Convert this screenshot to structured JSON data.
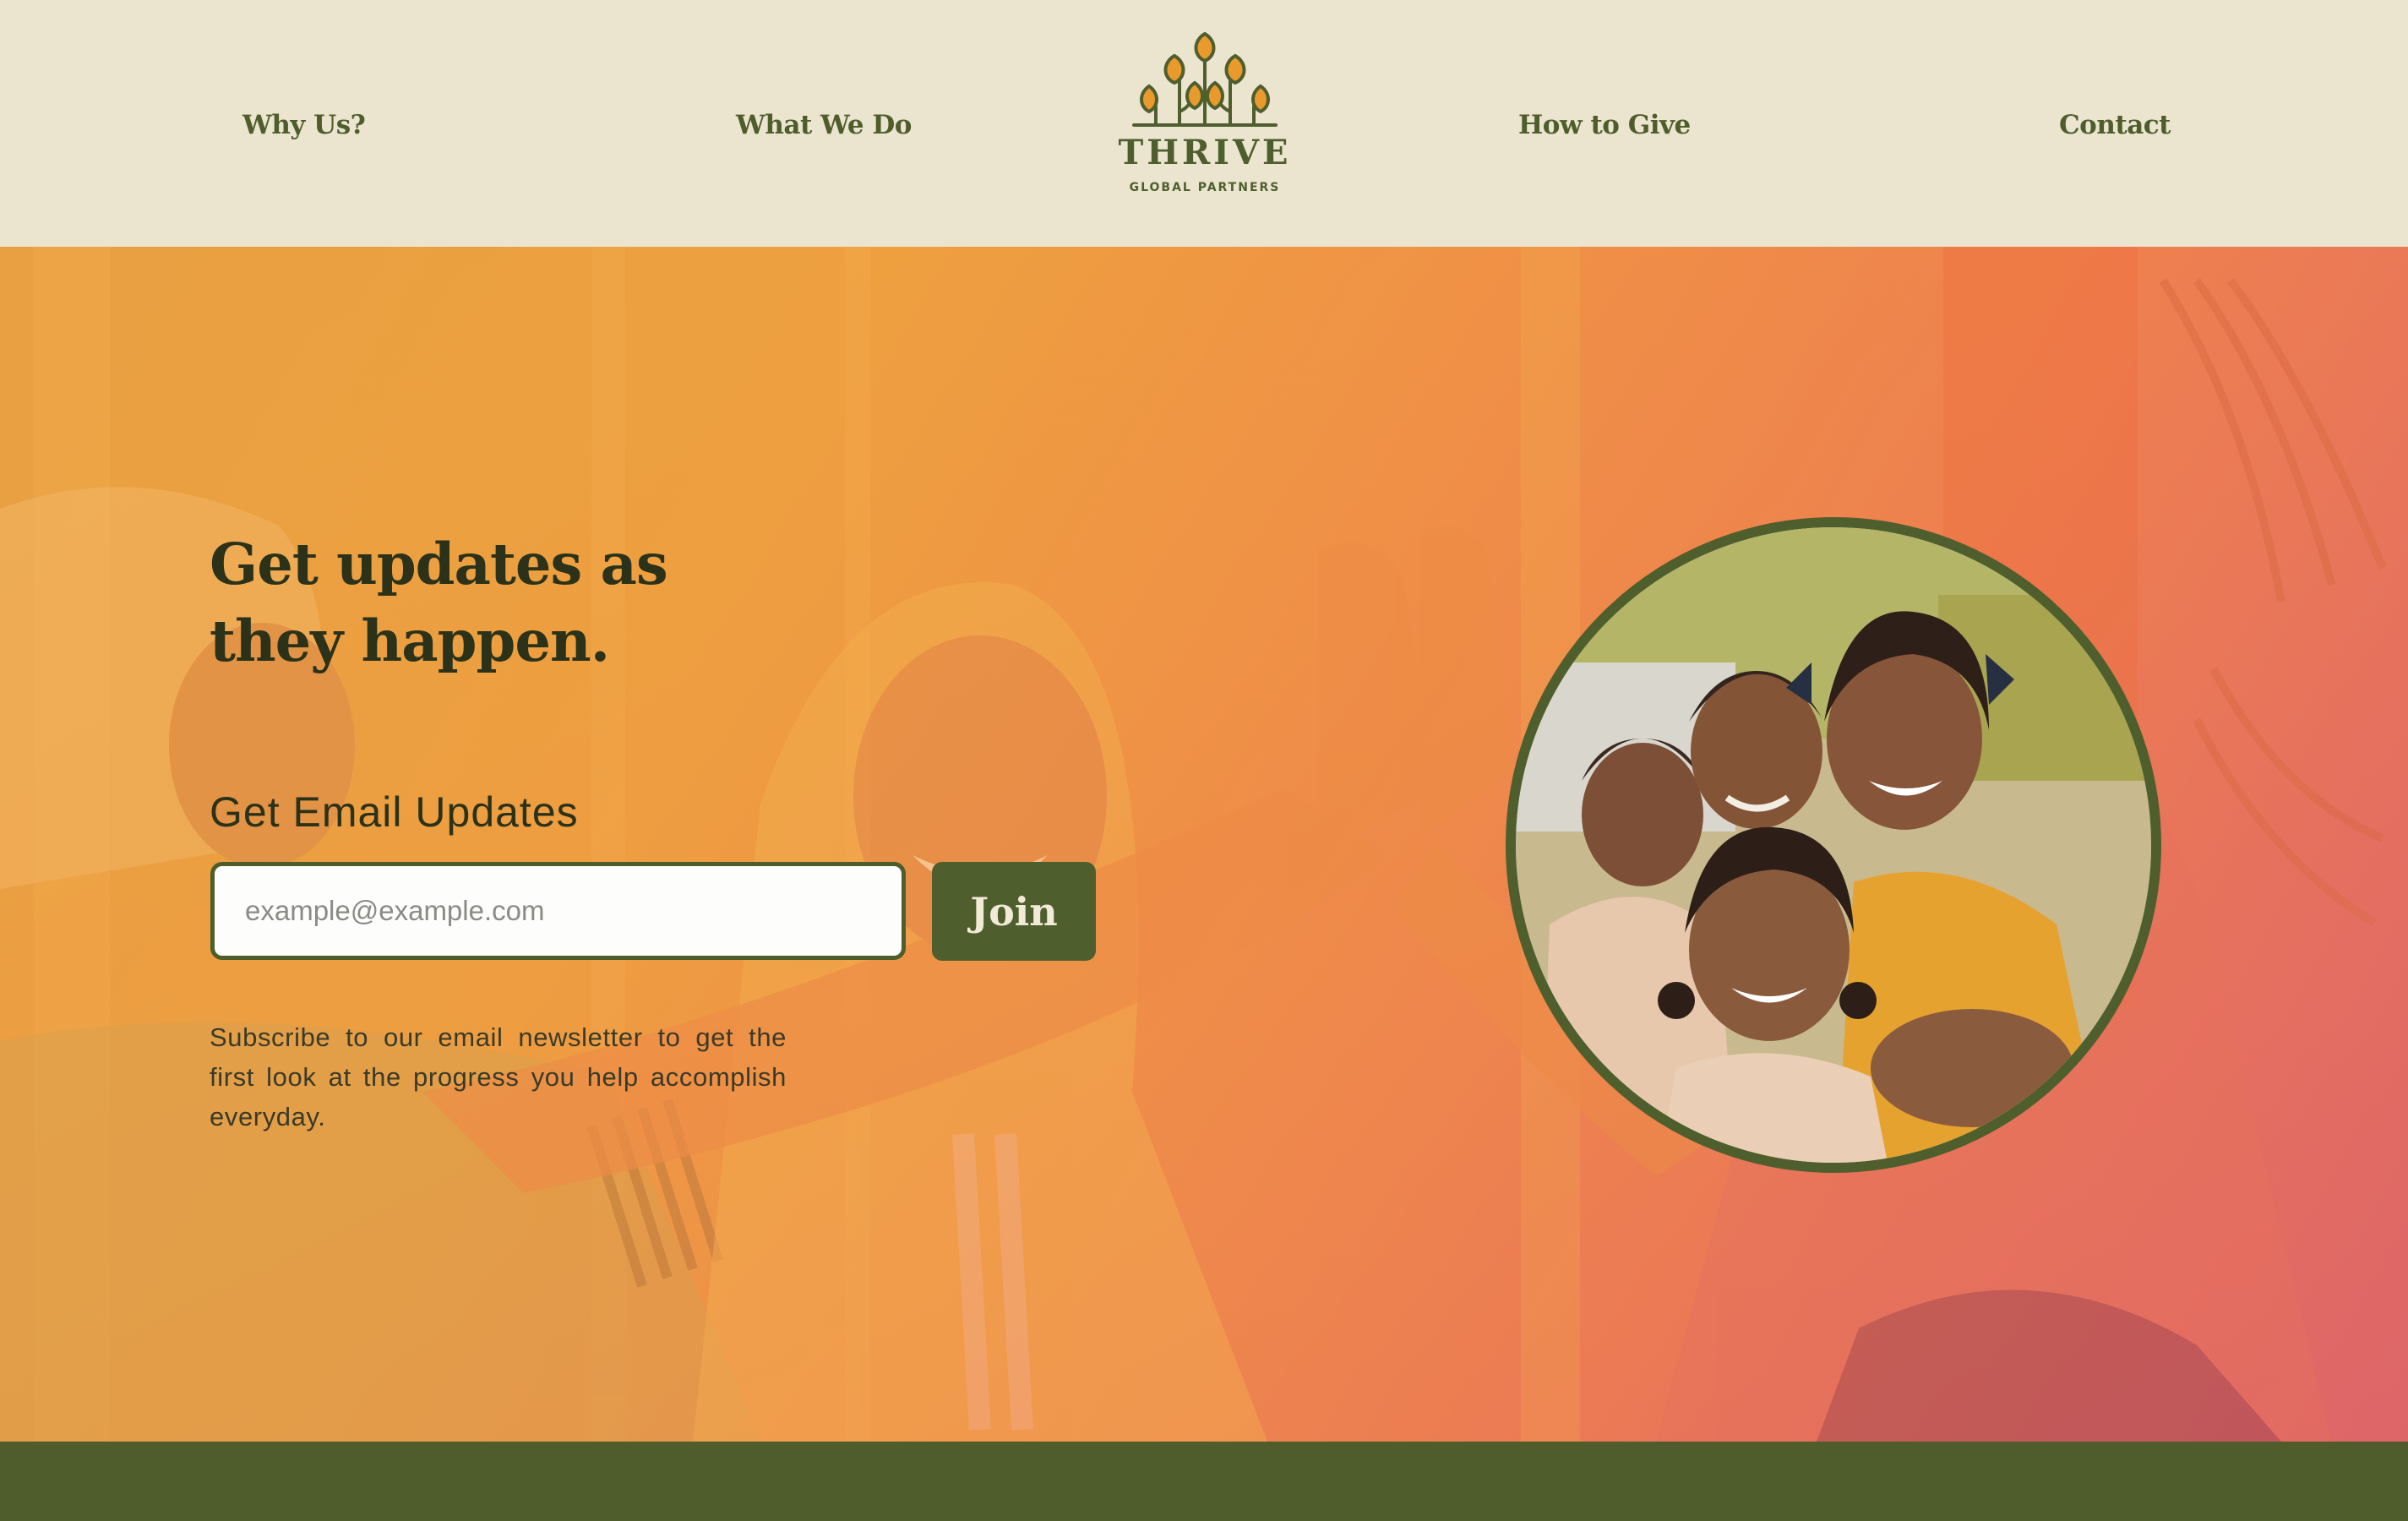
{
  "brand": {
    "name": "THRIVE",
    "tagline": "GLOBAL PARTNERS"
  },
  "nav": {
    "items": [
      {
        "label": "Why Us?"
      },
      {
        "label": "What We Do"
      },
      {
        "label": "How to Give"
      },
      {
        "label": "Contact"
      }
    ]
  },
  "hero": {
    "headline_line1": "Get updates as",
    "headline_line2": "they happen.",
    "form_title": "Get Email Updates",
    "email_placeholder": "example@example.com",
    "email_value": "",
    "join_label": "Join",
    "subscribe_text": "Subscribe to our email newsletter to get the first look at the progress you help accomplish everyday."
  },
  "colors": {
    "header_bg": "#ebe5d0",
    "brand_green": "#4f5e2d",
    "hero_orange": "#ee9a42",
    "hero_pink": "#dc6766"
  },
  "images": {
    "hero_background": "women-high-five-photo",
    "circle": "smiling-children-photo"
  }
}
